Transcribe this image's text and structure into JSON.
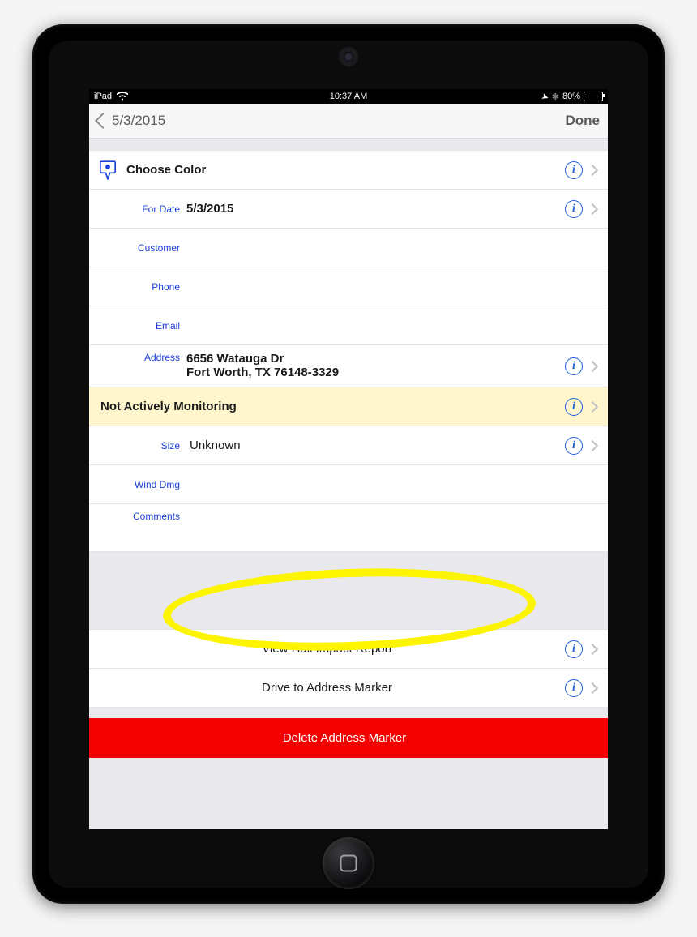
{
  "statusbar": {
    "carrier": "iPad",
    "time": "10:37 AM",
    "battery": "80%"
  },
  "nav": {
    "back": "5/3/2015",
    "done": "Done"
  },
  "fields": {
    "color_label": "Choose Color",
    "for_date_lbl": "For Date",
    "for_date": "5/3/2015",
    "customer_lbl": "Customer",
    "customer": "",
    "phone_lbl": "Phone",
    "phone": "",
    "email_lbl": "Email",
    "email": "",
    "address_lbl": "Address",
    "address_line1": "6656 Watauga Dr",
    "address_line2": "Fort Worth, TX 76148-3329",
    "monitor": "Not Actively Monitoring",
    "size_lbl": "Size",
    "size": "Unknown",
    "wind_lbl": "Wind Dmg",
    "wind": "",
    "comments_lbl": "Comments",
    "comments": ""
  },
  "actions": {
    "view_report": "View Hail Impact Report",
    "drive": "Drive to Address Marker",
    "delete": "Delete Address Marker"
  }
}
